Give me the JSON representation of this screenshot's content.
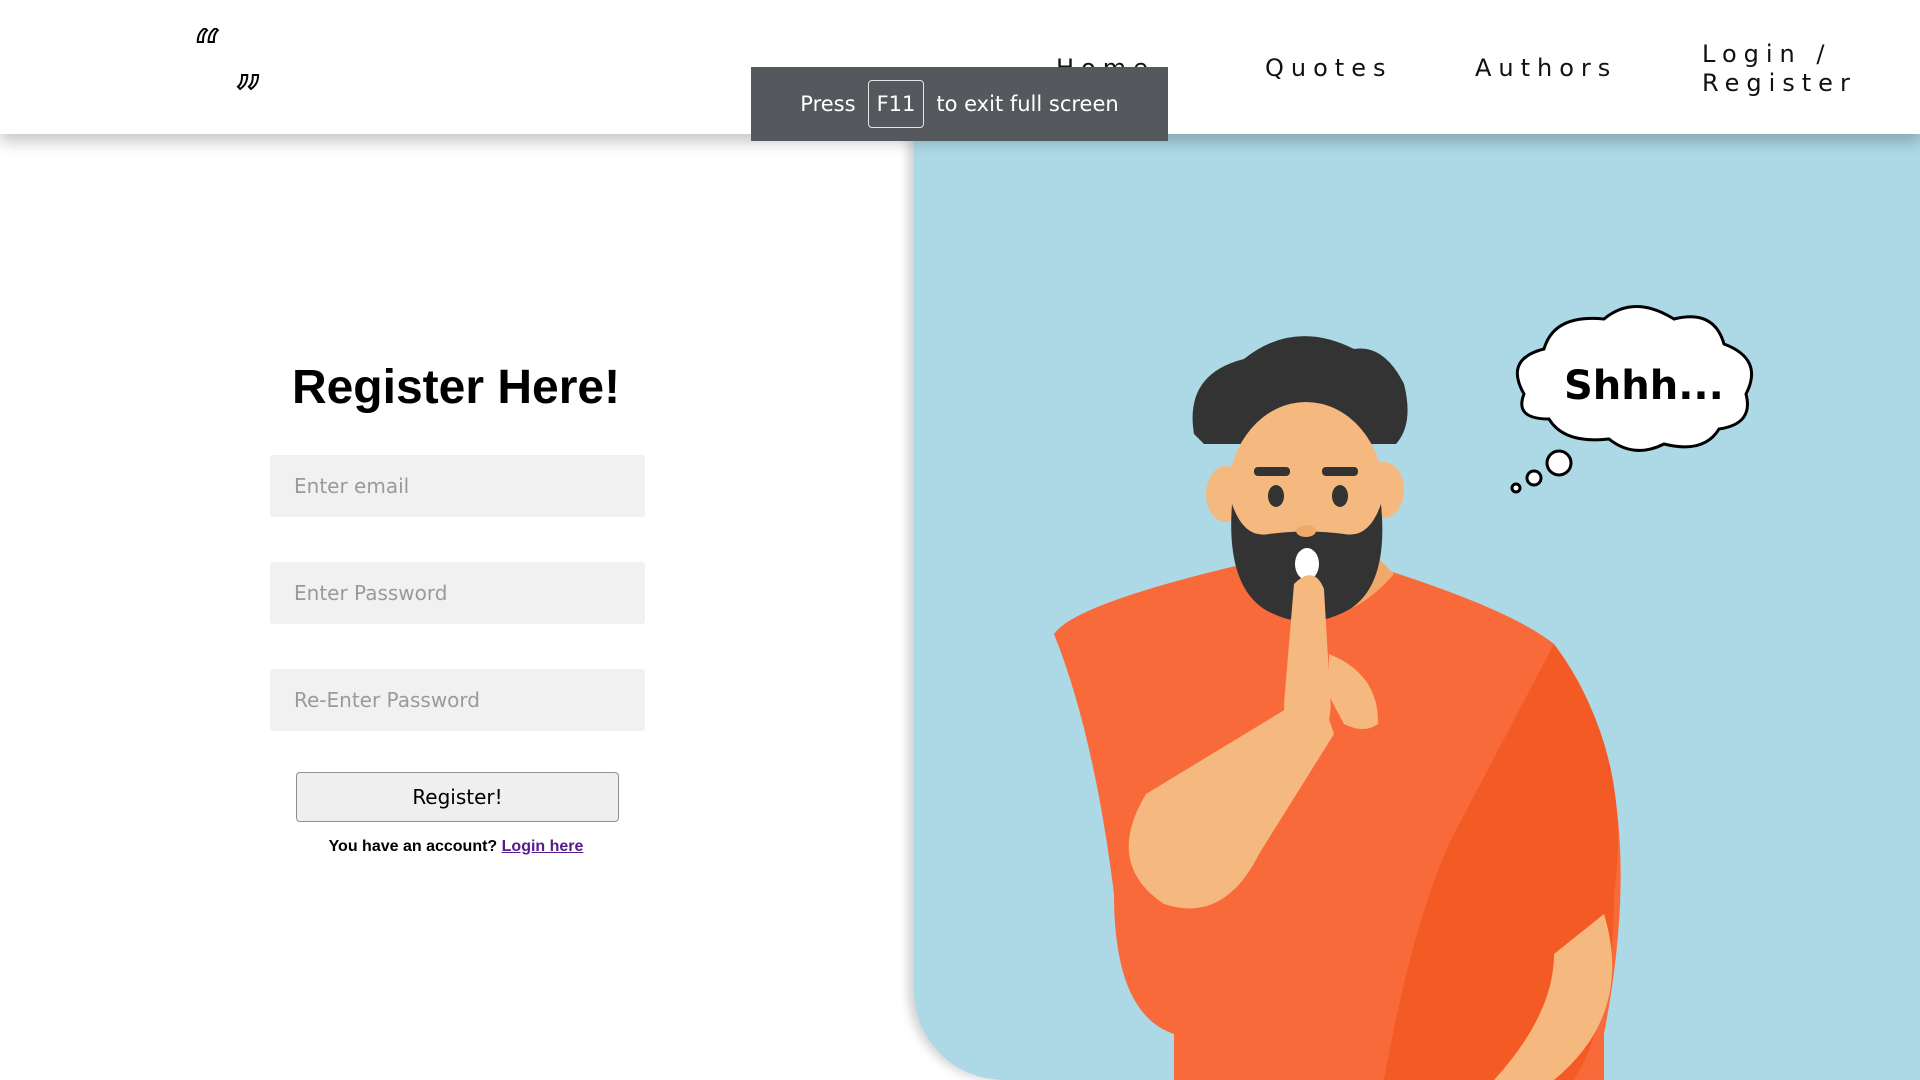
{
  "nav": {
    "logo_glyph": "“”",
    "items": [
      {
        "label": "Home"
      },
      {
        "label": "Quotes"
      },
      {
        "label": "Authors"
      },
      {
        "label": "Login / Register"
      }
    ]
  },
  "fullscreen_notice": {
    "prefix": "Press",
    "key": "F11",
    "suffix": "to exit full screen"
  },
  "register": {
    "title": "Register Here!",
    "email_placeholder": "Enter email",
    "password_placeholder": "Enter Password",
    "repassword_placeholder": "Re-Enter Password",
    "button_label": "Register!",
    "account_prompt": "You have an account?",
    "login_link": "Login here"
  },
  "illustration": {
    "thought_text": "Shhh..."
  },
  "colors": {
    "panel_bg": "#add8e5",
    "shirt": "#f96a3a",
    "skin": "#f5b97f",
    "hair": "#333333",
    "link": "#551a8b"
  }
}
